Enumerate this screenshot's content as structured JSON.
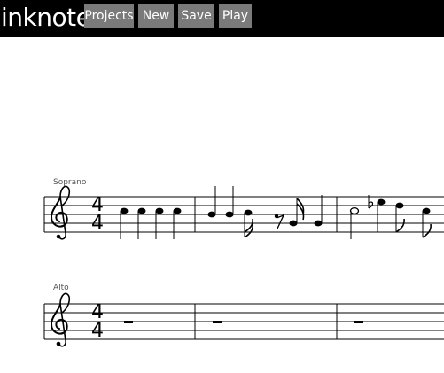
{
  "app": {
    "logo": "inknote"
  },
  "nav": {
    "projects": "Projects",
    "new": "New",
    "save": "Save",
    "play": "Play"
  },
  "score": {
    "staves": [
      {
        "label": "Soprano",
        "clef": "treble",
        "time_signature": {
          "top": "4",
          "bottom": "4"
        }
      },
      {
        "label": "Alto",
        "clef": "treble",
        "time_signature": {
          "top": "4",
          "bottom": "4"
        }
      }
    ]
  },
  "colors": {
    "topbar": "#000000",
    "button": "#7a7a7a",
    "button_text": "#ffffff",
    "ink": "#000000"
  }
}
